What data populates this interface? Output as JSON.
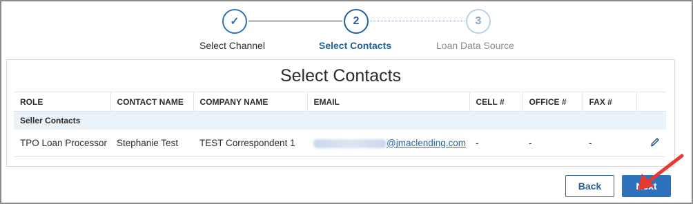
{
  "stepper": {
    "steps": [
      {
        "number": "✓",
        "label": "Select Channel"
      },
      {
        "number": "2",
        "label": "Select Contacts"
      },
      {
        "number": "3",
        "label": "Loan Data Source"
      }
    ]
  },
  "panel": {
    "title": "Select Contacts",
    "columns": [
      "ROLE",
      "CONTACT NAME",
      "COMPANY NAME",
      "EMAIL",
      "CELL #",
      "OFFICE #",
      "FAX #",
      ""
    ],
    "group_label": "Seller Contacts",
    "rows": [
      {
        "role": "TPO Loan Processor",
        "contact_name": "Stephanie Test",
        "company_name": "TEST Correspondent 1",
        "email_domain": "@jmaclending.com",
        "cell": "-",
        "office": "-",
        "fax": "-"
      }
    ]
  },
  "footer": {
    "back_label": "Back",
    "next_label": "Next"
  },
  "colors": {
    "accent": "#2e72bd",
    "annotation_arrow": "#e8392f"
  },
  "icons": [
    "check-icon",
    "edit-pencil-icon",
    "annotation-arrow"
  ]
}
